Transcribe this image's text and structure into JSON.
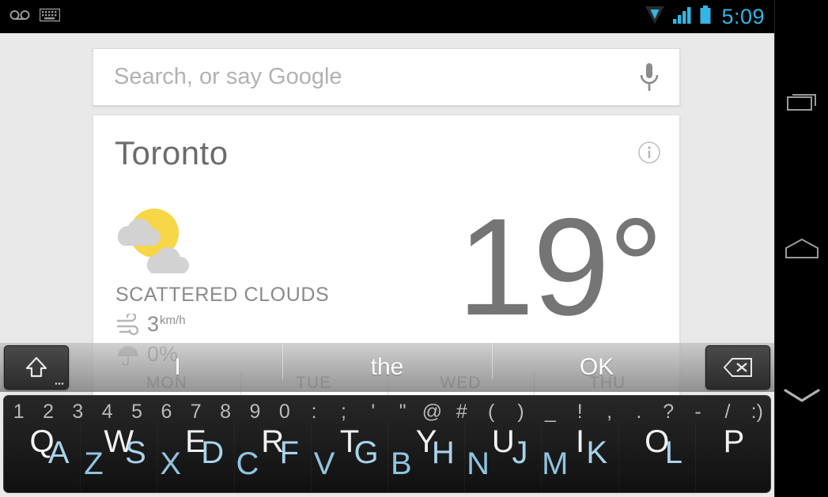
{
  "status_bar": {
    "time": "5:09",
    "accent_color": "#33b5e5",
    "left_icons": [
      {
        "name": "voicemail-icon",
        "glyph": "oo"
      },
      {
        "name": "keyboard-icon",
        "glyph": "keyboard"
      }
    ],
    "right_icons": [
      {
        "name": "wifi-icon"
      },
      {
        "name": "cell-signal-icon"
      },
      {
        "name": "battery-icon"
      }
    ]
  },
  "search": {
    "placeholder": "Search, or say Google",
    "value": "",
    "mic_icon": "microphone-icon"
  },
  "weather_card": {
    "city": "Toronto",
    "info_icon": "info-icon",
    "weather_icon": "sun-behind-clouds-icon",
    "condition": "SCATTERED CLOUDS",
    "temperature": "19°",
    "metrics": [
      {
        "icon": "wind-icon",
        "value": "3",
        "unit": "km/h"
      },
      {
        "icon": "umbrella-icon",
        "value": "0%",
        "unit": ""
      }
    ],
    "forecast": [
      {
        "day": "MON"
      },
      {
        "day": "TUE"
      },
      {
        "day": "WED"
      },
      {
        "day": "THU"
      }
    ]
  },
  "keyboard": {
    "shift_key": {
      "name": "shift-key",
      "icon": "shift-arrow-icon"
    },
    "backspace_key": {
      "name": "backspace-key",
      "icon": "backspace-x-icon"
    },
    "suggestions": [
      "I",
      "the",
      "OK"
    ],
    "symbol_row": [
      "1",
      "2",
      "3",
      "4",
      "5",
      "6",
      "7",
      "8",
      "9",
      "0",
      ":",
      ";",
      "'",
      "\"",
      "@",
      "#",
      "(",
      ")",
      "_",
      "!",
      ",",
      ".",
      "?",
      "-",
      "/",
      ":)"
    ],
    "letter_columns": [
      {
        "top": "Q",
        "mid": "A",
        "bot": "Z"
      },
      {
        "top": "W",
        "mid": "S",
        "bot": "X"
      },
      {
        "top": "E",
        "mid": "D",
        "bot": "C"
      },
      {
        "top": "R",
        "mid": "F",
        "bot": "V"
      },
      {
        "top": "T",
        "mid": "G",
        "bot": "B"
      },
      {
        "top": "Y",
        "mid": "H",
        "bot": "N"
      },
      {
        "top": "U",
        "mid": "J",
        "bot": "M"
      },
      {
        "top": "I",
        "mid": "K",
        "bot": ""
      },
      {
        "top": "O",
        "mid": "L",
        "bot": ""
      },
      {
        "top": "P",
        "mid": "",
        "bot": ""
      }
    ]
  },
  "nav_bar": {
    "buttons": [
      {
        "name": "recents-button",
        "icon": "recent-apps-icon"
      },
      {
        "name": "home-button",
        "icon": "home-icon"
      },
      {
        "name": "back-button",
        "icon": "chevron-down-icon"
      }
    ]
  }
}
